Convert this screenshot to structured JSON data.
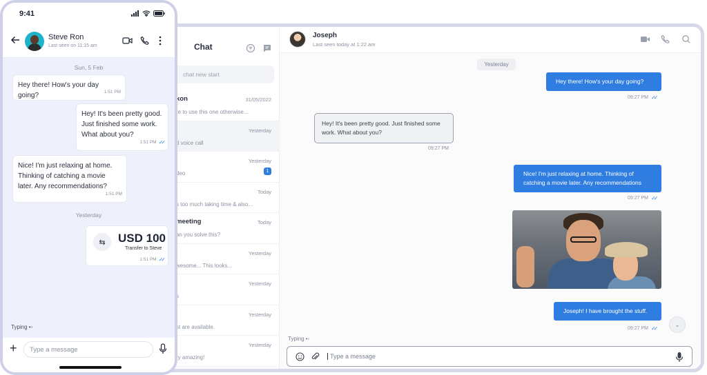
{
  "desktop": {
    "chat_list": {
      "title": "Chat",
      "search_placeholder": "chat new start",
      "items": [
        {
          "name": "kon",
          "preview": "re to use this one otherwise...",
          "date": "31/05/2022",
          "badge": ""
        },
        {
          "name": "",
          "preview": "d voice call",
          "date": "Yesterday",
          "badge": ""
        },
        {
          "name": "",
          "preview": "deo",
          "date": "Yesterday",
          "badge": "1"
        },
        {
          "name": "",
          "preview": "s too much taking time & also...",
          "date": "Today",
          "badge": ""
        },
        {
          "name": "meeting",
          "preview": "an you solve this?",
          "date": "Today",
          "badge": ""
        },
        {
          "name": "",
          "preview": "wesome... This looks...",
          "date": "Yesterday",
          "badge": ""
        },
        {
          "name": "l",
          "preview": "s",
          "date": "Yesterday",
          "badge": ""
        },
        {
          "name": "",
          "preview": "st are available.",
          "date": "Yesterday",
          "badge": ""
        },
        {
          "name": "",
          "preview": "ry amazing!",
          "date": "Yesterday",
          "badge": ""
        }
      ]
    },
    "conversation": {
      "contact_name": "Joseph",
      "contact_status": "Last seen today at 1:22 am",
      "day_label": "Yesterday",
      "messages": [
        {
          "direction": "out",
          "text": "Hey there! How's your day going?",
          "time": "09:27 PM"
        },
        {
          "direction": "in",
          "text": "Hey! It's been pretty good. Just finished some work. What about you?",
          "time": "09:27 PM"
        },
        {
          "direction": "out",
          "text": "Nice! I'm just relaxing at home. Thinking of catching a movie later. Any recommendations",
          "time": "09:27 PM"
        },
        {
          "direction": "out",
          "text": "Joseph! I have brought the stuff.",
          "time": "09:27 PM"
        }
      ],
      "typing_label": "Typing",
      "input_placeholder": "Type a message"
    }
  },
  "mobile": {
    "status_time": "9:41",
    "contact_name": "Steve Ron",
    "contact_status": "Last seen on 11:15 am",
    "day_1": "Sun, 5 Feb",
    "day_2": "Yesterday",
    "messages": [
      {
        "text": "Hey there! How's your day going?",
        "time": "1:51 PM"
      },
      {
        "text": "Hey! It's been pretty good. Just finished some work. What about you?",
        "time": "1:51 PM"
      },
      {
        "text": "Nice! I'm just relaxing at home. Thinking of catching a movie later. Any recommendations?",
        "time": "1:51 PM"
      }
    ],
    "transfer": {
      "amount": "USD 100",
      "description": "Transfer to Steve",
      "time": "1:51 PM"
    },
    "typing_label": "Typing",
    "input_placeholder": "Type a message"
  },
  "colors": {
    "accent": "#2f7de1",
    "phone_bg": "#eef1fb",
    "frame": "#d7d9e9"
  },
  "icons": [
    "video-icon",
    "phone-icon",
    "search-icon",
    "more-icon",
    "back-icon",
    "emoji-icon",
    "attach-icon",
    "mic-icon",
    "plus-icon",
    "swap-icon",
    "chevron-down-icon",
    "filter-icon",
    "new-chat-icon"
  ]
}
